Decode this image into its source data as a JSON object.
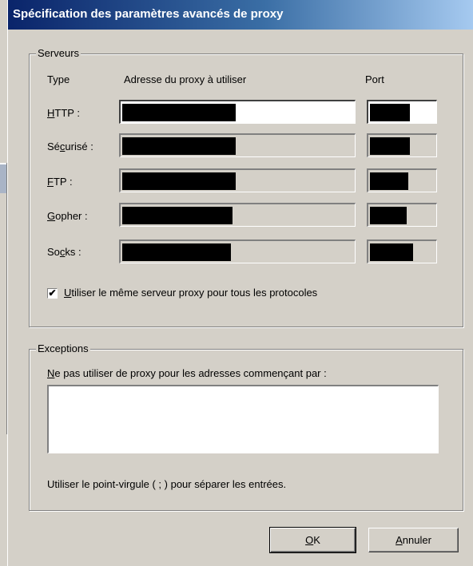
{
  "dialog": {
    "title": "Spécification des paramètres avancés de proxy"
  },
  "servers": {
    "group_label": "Serveurs",
    "col_type": "Type",
    "col_address": "Adresse du proxy à utiliser",
    "col_port": "Port",
    "rows": [
      {
        "label_pre": "",
        "label_key": "H",
        "label_post": "TTP :",
        "address": "[redacted]",
        "port": "[redacted]",
        "enabled": true
      },
      {
        "label_pre": "Sé",
        "label_key": "c",
        "label_post": "urisé :",
        "address": "[redacted]",
        "port": "[redacted]",
        "enabled": false
      },
      {
        "label_pre": "",
        "label_key": "F",
        "label_post": "TP :",
        "address": "[redacted]",
        "port": "[redacted]",
        "enabled": false
      },
      {
        "label_pre": "",
        "label_key": "G",
        "label_post": "opher :",
        "address": "[redacted]",
        "port": "[redacted]",
        "enabled": false
      },
      {
        "label_pre": "So",
        "label_key": "c",
        "label_post": "ks :",
        "address": "[redacted]",
        "port": "[redacted]",
        "enabled": false
      }
    ],
    "same_proxy_key": "U",
    "same_proxy_rest": "tiliser le même serveur proxy pour tous les protocoles",
    "same_proxy_checked": true,
    "check_mark": "✔"
  },
  "exceptions": {
    "group_label": "Exceptions",
    "prompt_key": "N",
    "prompt_rest": "e pas utiliser de proxy pour les adresses commençant par :",
    "value": "",
    "hint": "Utiliser le point-virgule ( ; ) pour séparer les entrées."
  },
  "buttons": {
    "ok_key": "O",
    "ok_rest": "K",
    "cancel_key": "A",
    "cancel_rest": "nnuler"
  }
}
